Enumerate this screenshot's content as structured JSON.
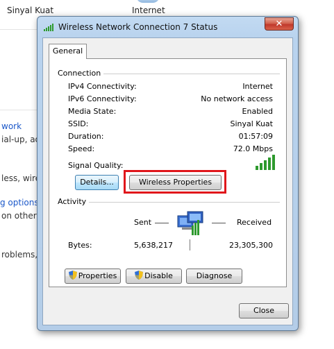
{
  "background": {
    "top_left_label": "Sinyal Kuat",
    "top_center_label": "Internet",
    "fragments": [
      "work",
      "ial-up, ad",
      "less, wired",
      "g options",
      "on other",
      "roblems, o"
    ]
  },
  "window": {
    "title": "Wireless Network Connection 7 Status",
    "close_label": "✕",
    "tabs": [
      {
        "label": "General"
      }
    ],
    "connection": {
      "section_label": "Connection",
      "rows": [
        {
          "label": "IPv4 Connectivity:",
          "value": "Internet"
        },
        {
          "label": "IPv6 Connectivity:",
          "value": "No network access"
        },
        {
          "label": "Media State:",
          "value": "Enabled"
        },
        {
          "label": "SSID:",
          "value": "Sinyal Kuat"
        },
        {
          "label": "Duration:",
          "value": "01:57:09"
        },
        {
          "label": "Speed:",
          "value": "72.0 Mbps"
        }
      ],
      "signal_quality_label": "Signal Quality:",
      "signal_bars": 5,
      "details_button": "Details...",
      "wireless_properties_button": "Wireless Properties"
    },
    "activity": {
      "section_label": "Activity",
      "sent_label": "Sent",
      "received_label": "Received",
      "bytes_label": "Bytes:",
      "bytes_sent": "5,638,217",
      "bytes_received": "23,305,300"
    },
    "buttons": {
      "properties": "Properties",
      "disable": "Disable",
      "diagnose": "Diagnose",
      "close": "Close"
    }
  },
  "colors": {
    "highlight": "#e0161b",
    "link": "#1a57c9",
    "signal": "#2e9a2e"
  }
}
